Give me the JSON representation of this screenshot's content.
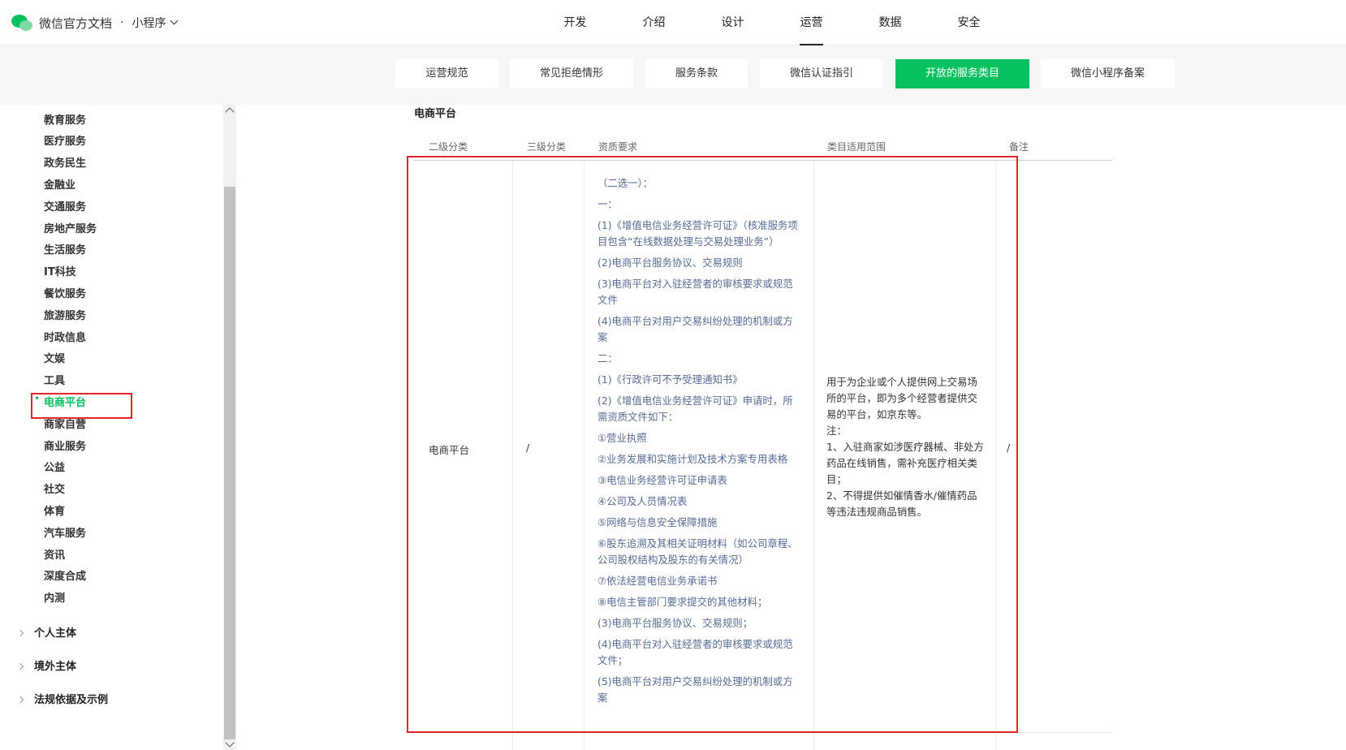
{
  "header": {
    "title": "微信官方文档",
    "separator": "·",
    "product": "小程序",
    "nav": [
      {
        "label": "开发",
        "active": false
      },
      {
        "label": "介绍",
        "active": false
      },
      {
        "label": "设计",
        "active": false
      },
      {
        "label": "运营",
        "active": true
      },
      {
        "label": "数据",
        "active": false
      },
      {
        "label": "安全",
        "active": false
      }
    ]
  },
  "subnav": {
    "tabs": [
      {
        "label": "运营规范",
        "active": false
      },
      {
        "label": "常见拒绝情形",
        "active": false
      },
      {
        "label": "服务条款",
        "active": false
      },
      {
        "label": "微信认证指引",
        "active": false
      },
      {
        "label": "开放的服务类目",
        "active": true
      },
      {
        "label": "微信小程序备案",
        "active": false
      }
    ]
  },
  "sidebar": {
    "items": [
      {
        "label": "教育服务"
      },
      {
        "label": "医疗服务"
      },
      {
        "label": "政务民生"
      },
      {
        "label": "金融业"
      },
      {
        "label": "交通服务"
      },
      {
        "label": "房地产服务"
      },
      {
        "label": "生活服务"
      },
      {
        "label": "IT科技"
      },
      {
        "label": "餐饮服务"
      },
      {
        "label": "旅游服务"
      },
      {
        "label": "时政信息"
      },
      {
        "label": "文娱"
      },
      {
        "label": "工具"
      },
      {
        "label": "电商平台",
        "active": true
      },
      {
        "label": "商家自营"
      },
      {
        "label": "商业服务"
      },
      {
        "label": "公益"
      },
      {
        "label": "社交"
      },
      {
        "label": "体育"
      },
      {
        "label": "汽车服务"
      },
      {
        "label": "资讯"
      },
      {
        "label": "深度合成"
      },
      {
        "label": "内测"
      }
    ],
    "groups": [
      {
        "label": "个人主体"
      },
      {
        "label": "境外主体"
      },
      {
        "label": "法规依据及示例"
      }
    ],
    "active_bullet": "•"
  },
  "main": {
    "section_title": "电商平台",
    "table": {
      "headers": [
        "二级分类",
        "三级分类",
        "资质要求",
        "类目适用范围",
        "备注"
      ],
      "row": {
        "level2": "电商平台",
        "level3": "/",
        "qualifications": [
          "（二选一）：",
          "一：",
          "(1)《增值电信业务经营许可证》（核准服务项目包含“在线数据处理与交易处理业务”）",
          "(2)电商平台服务协议、交易规则",
          "(3)电商平台对入驻经营者的审核要求或规范文件",
          "(4)电商平台对用户交易纠纷处理的机制或方案",
          "二：",
          "(1)《行政许可不予受理通知书》",
          "(2)《增值电信业务经营许可证》申请时，所需资质文件如下：",
          "①营业执照",
          "②业务发展和实施计划及技术方案专用表格",
          "③电信业务经营许可证申请表",
          "④公司及人员情况表",
          "⑤网络与信息安全保障措施",
          "⑥股东追溯及其相关证明材料（如公司章程、公司股权结构及股东的有关情况）",
          "⑦依法经营电信业务承诺书",
          "⑧电信主管部门要求提交的其他材料；",
          "(3)电商平台服务协议、交易规则；",
          "(4)电商平台对入驻经营者的审核要求或规范文件；",
          "(5)电商平台对用户交易纠纷处理的机制或方案"
        ],
        "scope": [
          "用于为企业或个人提供网上交易场所的平台，即为多个经营者提供交易的平台，如京东等。",
          "注：",
          "1、入驻商家如涉医疗器械、非处方药品在线销售，需补充医疗相关类目；",
          "2、不得提供如催情香水/催情药品等违法违规商品销售。"
        ],
        "remark": "/"
      }
    }
  },
  "colors": {
    "accent": "#07c160",
    "link": "#576b95",
    "highlight": "#e0262a"
  }
}
